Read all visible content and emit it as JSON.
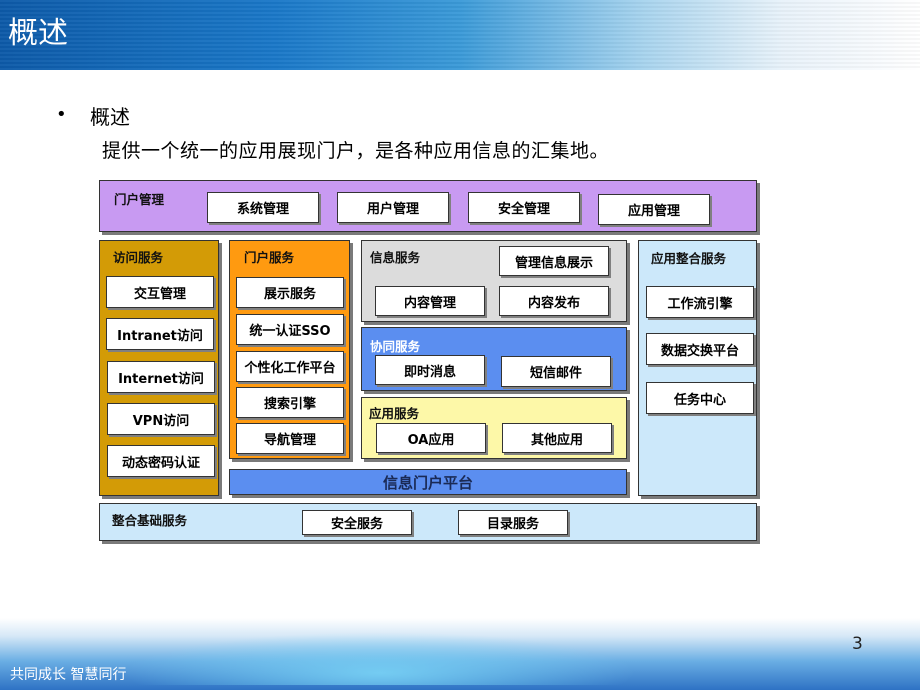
{
  "header": {
    "title": "概述"
  },
  "content": {
    "bullet": "•",
    "heading": "概述",
    "description": "提供一个统一的应用展现门户，是各种应用信息的汇集地。"
  },
  "diagram": {
    "portal_management": {
      "title": "门户管理",
      "color": "#c89af2",
      "items": [
        "系统管理",
        "用户管理",
        "安全管理",
        "应用管理"
      ]
    },
    "access_services": {
      "title": "访问服务",
      "color": "#d39b06",
      "items": [
        "交互管理",
        "Intranet访问",
        "Internet访问",
        "VPN访问",
        "动态密码认证"
      ]
    },
    "portal_services": {
      "title": "门户服务",
      "color": "#ff9a10",
      "items": [
        "展示服务",
        "统一认证SSO",
        "个性化工作平台",
        "搜索引擎",
        "导航管理"
      ]
    },
    "info_services": {
      "title": "信息服务",
      "color": "#dcdcdc",
      "items": [
        "管理信息展示",
        "内容管理",
        "内容发布"
      ]
    },
    "collab_services": {
      "title": "协同服务",
      "color": "#5b8ef0",
      "items": [
        "即时消息",
        "短信邮件"
      ]
    },
    "app_services": {
      "title": "应用服务",
      "color": "#fdf8a8",
      "items": [
        "OA应用",
        "其他应用"
      ]
    },
    "platform_bar": {
      "title": "信息门户平台",
      "color": "#5b8ef0"
    },
    "integration_services": {
      "title": "应用整合服务",
      "color": "#cce8fa",
      "items": [
        "工作流引擎",
        "数据交换平台",
        "任务中心"
      ]
    },
    "base_services": {
      "title": "整合基础服务",
      "color": "#cce8fa",
      "items": [
        "安全服务",
        "目录服务"
      ]
    }
  },
  "footer": {
    "slogan": "共同成长  智慧同行",
    "page_number": "3"
  }
}
